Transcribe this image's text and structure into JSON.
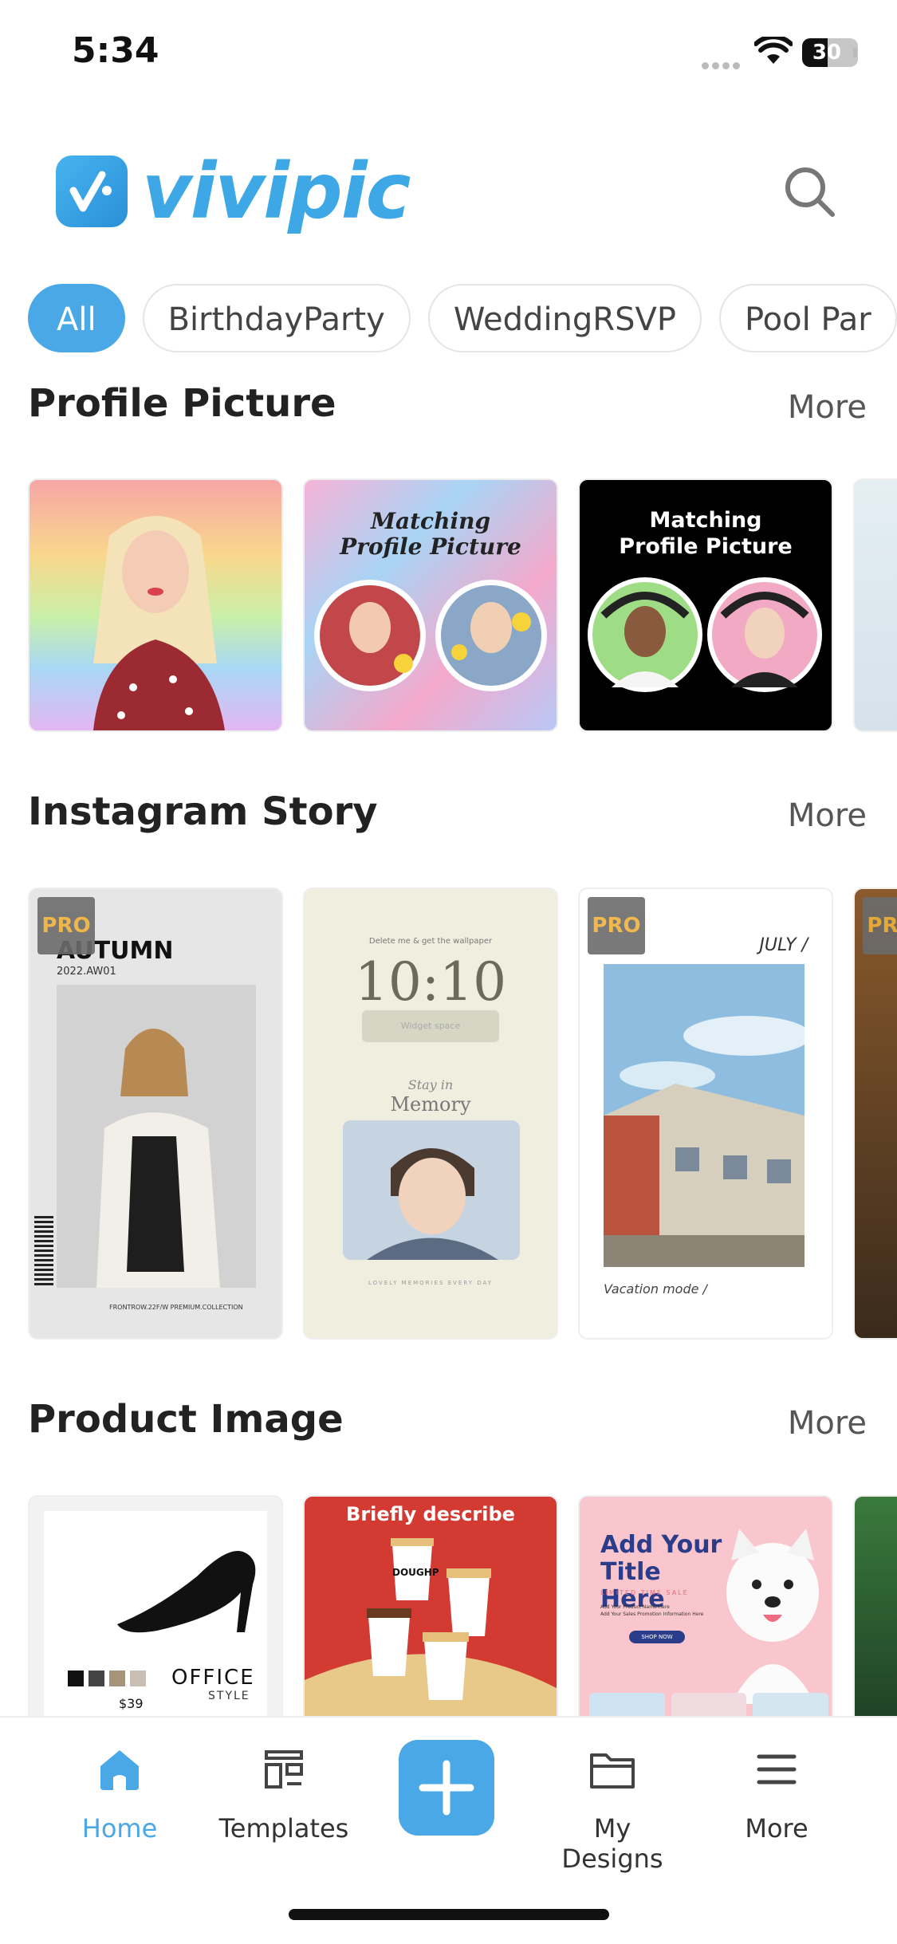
{
  "status_bar": {
    "time": "5:34",
    "battery": "30"
  },
  "app": {
    "name": "vivipic"
  },
  "filters": [
    {
      "label": "All",
      "active": true
    },
    {
      "label": "BirthdayParty",
      "active": false
    },
    {
      "label": "WeddingRSVP",
      "active": false
    },
    {
      "label": "Pool Par",
      "active": false
    }
  ],
  "sections": {
    "profile": {
      "title": "Profile Picture",
      "more": "More",
      "cards": [
        {
          "text": ""
        },
        {
          "text": "Matching\nProfile Picture"
        },
        {
          "text": "Matching\nProfile Picture"
        }
      ]
    },
    "story": {
      "title": "Instagram Story",
      "more": "More",
      "pro_label": "PRO",
      "card1": {
        "title": "AUTUMN",
        "sub": "2022.AW01",
        "footer": "FRONTROW.22F/W PREMIUM.COLLECTION"
      },
      "card2": {
        "top": "Delete me & get the wallpaper",
        "time": "10:10",
        "widget": "Widget space",
        "script": "Stay in",
        "memory": "Memory",
        "footer": "LOVELY MEMORIES EVERY DAY"
      },
      "card3": {
        "month": "JULY /",
        "caption": "Vacation mode /"
      }
    },
    "product": {
      "title": "Product Image",
      "more": "More",
      "card1": {
        "brand": "OFFICE",
        "sub": "STYLE",
        "price": "$39"
      },
      "card2": {
        "headline": "Briefly describe",
        "cup": "DOUGHP"
      },
      "card3": {
        "headline": "Add Your Title Here",
        "tagline": "LIMITED TIME SALE",
        "body": "Add Your Product Name Here\nAdd Your Sales Promotion Information Here",
        "button": "SHOP NOW"
      }
    }
  },
  "tabbar": {
    "home": "Home",
    "templates": "Templates",
    "my_designs": "My Designs",
    "more": "More"
  },
  "colors": {
    "accent": "#4aa8e6",
    "pro": "#f0b23a"
  }
}
